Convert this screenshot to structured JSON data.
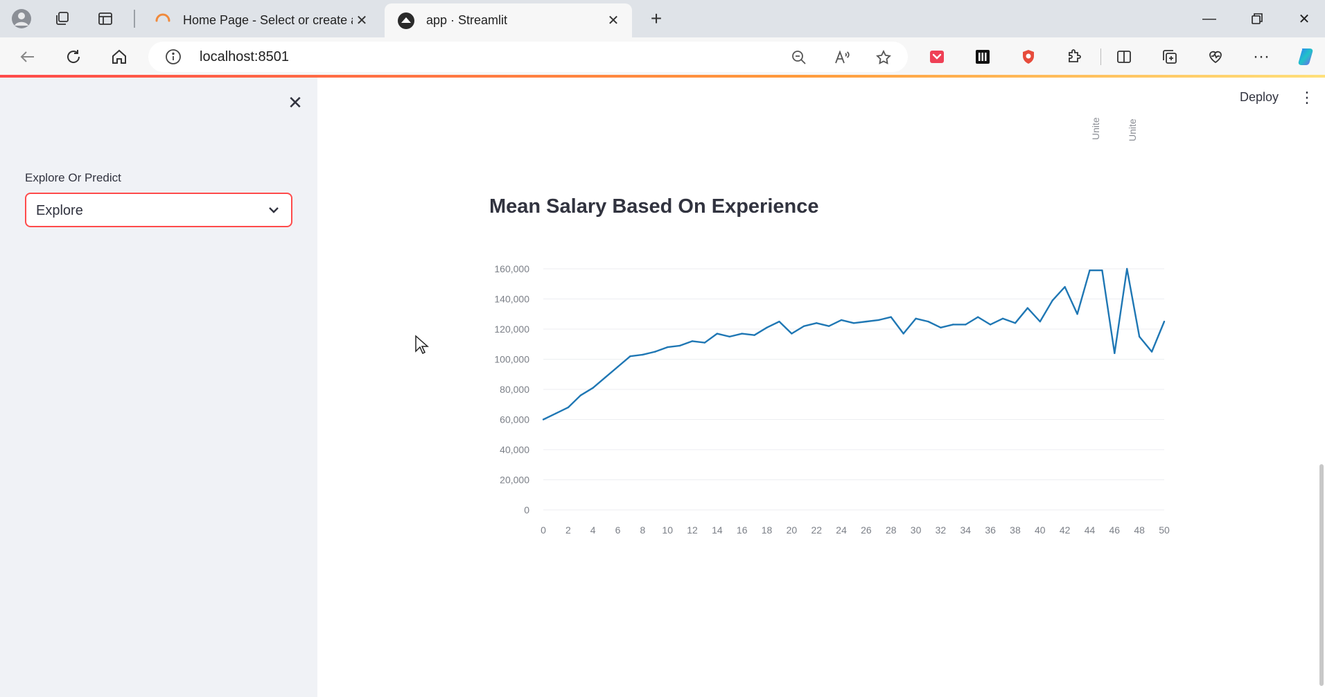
{
  "browser": {
    "tabs": [
      {
        "title": "Home Page - Select or create a n",
        "active": false,
        "favicon": "loading-spinner-icon"
      },
      {
        "title": "app · Streamlit",
        "active": true,
        "favicon": "streamlit-icon"
      }
    ],
    "url": "localhost:8501"
  },
  "sidebar": {
    "label": "Explore Or Predict",
    "select_value": "Explore"
  },
  "header": {
    "deploy_label": "Deploy"
  },
  "rotated_labels": [
    "Unite",
    "Unite"
  ],
  "colors": {
    "accent": "#ff4b4b",
    "line": "#1f77b4",
    "sidebar_bg": "#f0f2f6"
  },
  "chart_data": {
    "type": "line",
    "title": "Mean Salary Based On Experience",
    "xlabel": "",
    "ylabel": "",
    "x": [
      0,
      1,
      2,
      3,
      4,
      5,
      6,
      7,
      8,
      9,
      10,
      11,
      12,
      13,
      14,
      15,
      16,
      17,
      18,
      19,
      20,
      21,
      22,
      23,
      24,
      25,
      26,
      27,
      28,
      29,
      30,
      31,
      32,
      33,
      34,
      35,
      36,
      37,
      38,
      39,
      40,
      41,
      42,
      43,
      44,
      45,
      46,
      47,
      48,
      49,
      50
    ],
    "series": [
      {
        "values": [
          60000,
          64000,
          68000,
          76000,
          81000,
          88000,
          95000,
          102000,
          103000,
          105000,
          108000,
          109000,
          112000,
          111000,
          117000,
          115000,
          117000,
          116000,
          121000,
          125000,
          117000,
          122000,
          124000,
          122000,
          126000,
          124000,
          125000,
          126000,
          128000,
          117000,
          127000,
          125000,
          121000,
          123000,
          123000,
          128000,
          123000,
          127000,
          124000,
          134000,
          125000,
          139000,
          148000,
          130000,
          159000,
          159000,
          104000,
          160000,
          115000,
          105000,
          125000
        ]
      }
    ],
    "xticks": [
      "0",
      "2",
      "4",
      "6",
      "8",
      "10",
      "12",
      "14",
      "16",
      "18",
      "20",
      "22",
      "24",
      "26",
      "28",
      "30",
      "32",
      "34",
      "36",
      "38",
      "40",
      "42",
      "44",
      "46",
      "48",
      "50"
    ],
    "yticks": [
      "0",
      "20,000",
      "40,000",
      "60,000",
      "80,000",
      "100,000",
      "120,000",
      "140,000",
      "160,000"
    ],
    "xlim": [
      0,
      50
    ],
    "ylim": [
      0,
      160000
    ],
    "grid": true
  }
}
